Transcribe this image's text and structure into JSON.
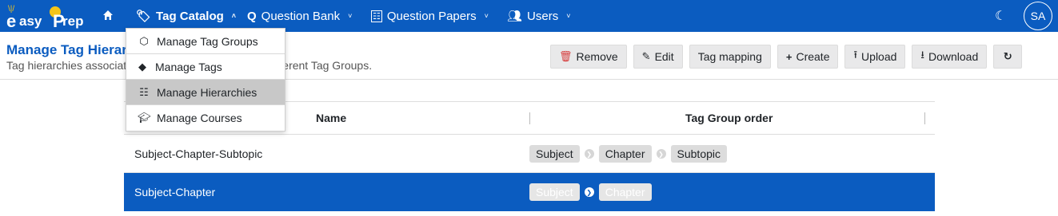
{
  "brand": {
    "e": "e",
    "asy": "asy",
    "p": "P",
    "rep": "rep"
  },
  "nav": {
    "tag_catalog": "Tag Catalog",
    "question_bank": "Question Bank",
    "question_papers": "Question Papers",
    "users": "Users",
    "avatar": "SA"
  },
  "header": {
    "title": "Manage Tag Hierarchies",
    "subtitle": "Tag hierarchies associate tag group ordering among different Tag Groups."
  },
  "toolbar": {
    "remove": "Remove",
    "edit": "Edit",
    "tag_mapping": "Tag mapping",
    "create": "Create",
    "upload": "Upload",
    "download": "Download"
  },
  "dropdown": {
    "items": [
      {
        "label": "Manage Tag Groups",
        "icon": "tags-icon"
      },
      {
        "label": "Manage Tags",
        "icon": "tag-icon"
      },
      {
        "label": "Manage Hierarchies",
        "icon": "hierarchy-icon"
      },
      {
        "label": "Manage Courses",
        "icon": "graduation-cap-icon"
      }
    ]
  },
  "table": {
    "columns": [
      "Name",
      "Tag Group order"
    ],
    "rows": [
      {
        "name": "Subject-Chapter-Subtopic",
        "order": [
          "Subject",
          "Chapter",
          "Subtopic"
        ]
      },
      {
        "name": "Subject-Chapter",
        "order": [
          "Subject",
          "Chapter"
        ]
      }
    ]
  },
  "colors": {
    "primary": "#0b5cc0",
    "accent": "#f5c518",
    "danger": "#d63b3b"
  }
}
